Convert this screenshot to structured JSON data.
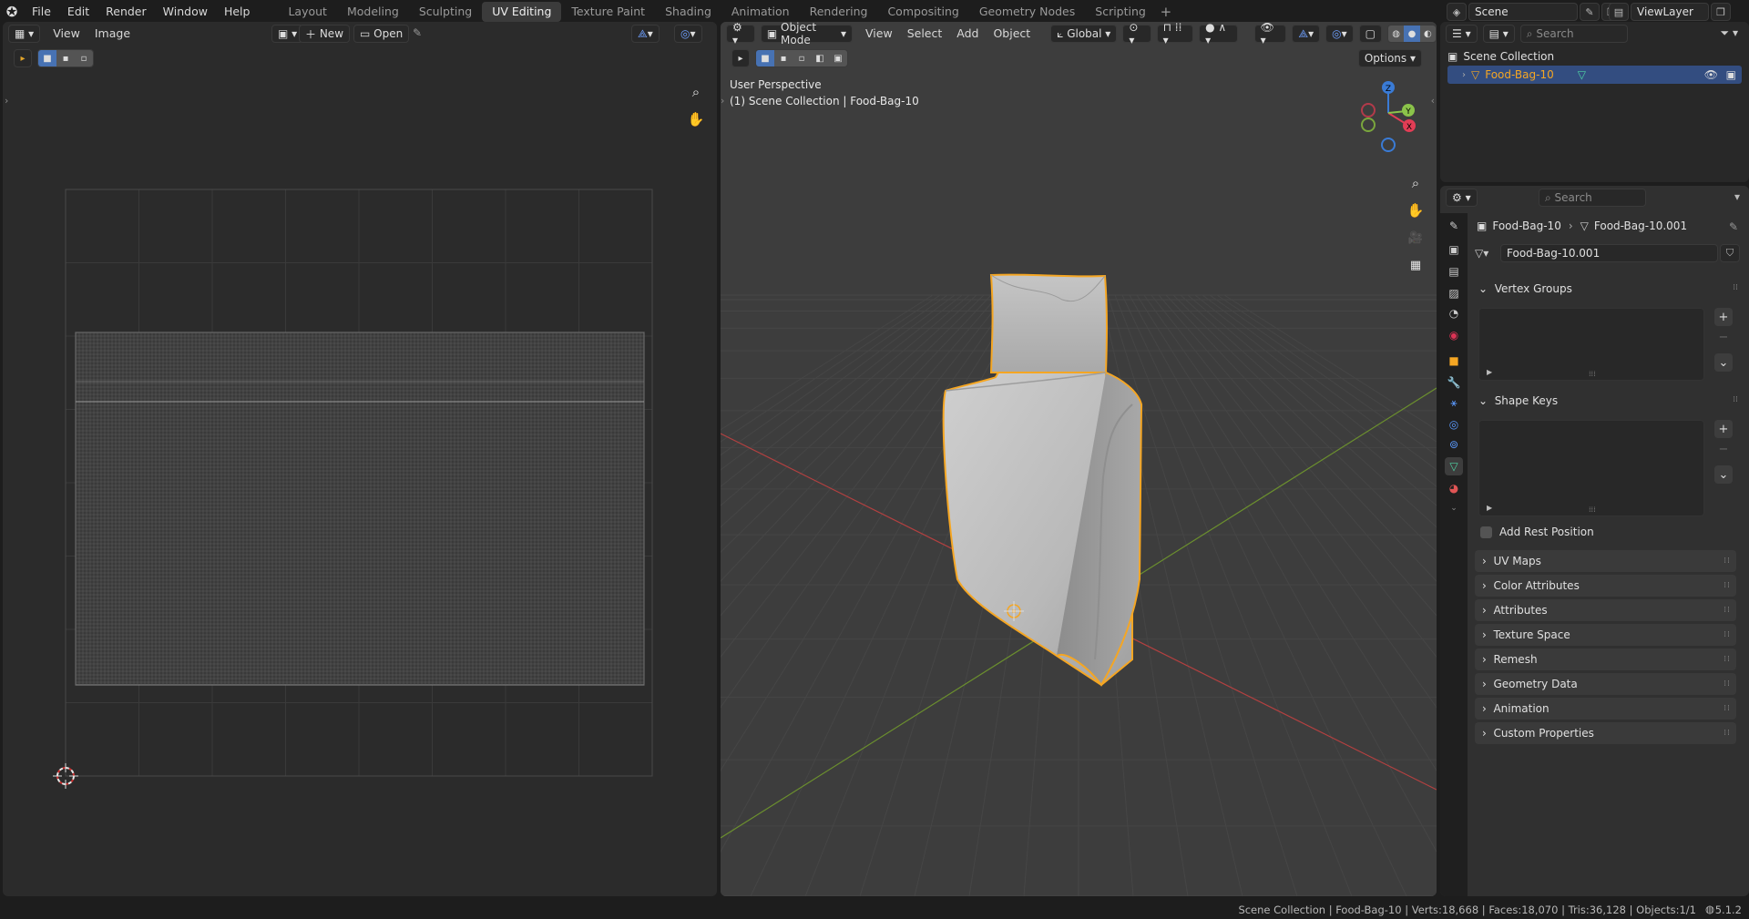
{
  "topbar": {
    "menus": [
      "File",
      "Edit",
      "Render",
      "Window",
      "Help"
    ],
    "workspaces": [
      "Layout",
      "Modeling",
      "Sculpting",
      "UV Editing",
      "Texture Paint",
      "Shading",
      "Animation",
      "Rendering",
      "Compositing",
      "Geometry Nodes",
      "Scripting"
    ],
    "active_workspace": "UV Editing",
    "scene": "Scene",
    "view_layer": "ViewLayer"
  },
  "uv_editor": {
    "menus": [
      "View",
      "Image"
    ],
    "new_label": "New",
    "open_label": "Open"
  },
  "viewport": {
    "mode": "Object Mode",
    "menus": [
      "View",
      "Select",
      "Add",
      "Object"
    ],
    "orientation": "Global",
    "options_label": "Options",
    "perspective_label": "User Perspective",
    "collection_label": "(1) Scene Collection | Food-Bag-10"
  },
  "outliner": {
    "search_placeholder": "Search",
    "collection": "Scene Collection",
    "object": "Food-Bag-10"
  },
  "properties": {
    "search_placeholder": "Search",
    "breadcrumb_object": "Food-Bag-10",
    "breadcrumb_mesh": "Food-Bag-10.001",
    "mesh_name": "Food-Bag-10.001",
    "vertex_groups": "Vertex Groups",
    "shape_keys": "Shape Keys",
    "add_rest_position": "Add Rest Position",
    "panels": [
      "UV Maps",
      "Color Attributes",
      "Attributes",
      "Texture Space",
      "Remesh",
      "Geometry Data",
      "Animation",
      "Custom Properties"
    ]
  },
  "statusbar": {
    "text": "Scene Collection | Food-Bag-10 | Verts:18,668 | Faces:18,070 | Tris:36,128 | Objects:1/1",
    "version": "5.1.2"
  },
  "colors": {
    "accent": "#4772b3",
    "selection_orange": "#f5a623",
    "x_axis": "#e23d55",
    "y_axis": "#8bc34a",
    "z_axis": "#3a7bd5"
  }
}
